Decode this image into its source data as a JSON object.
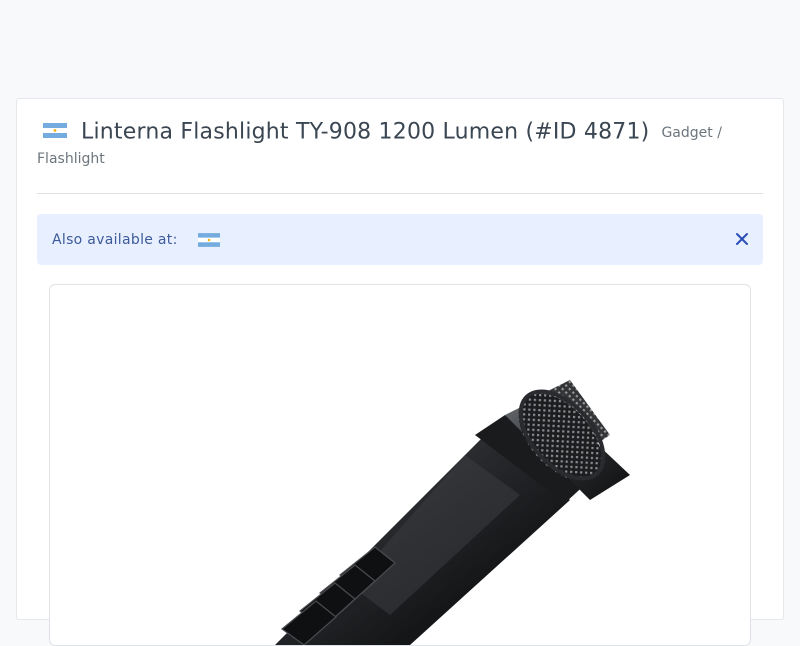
{
  "product": {
    "title": "Linterna Flashlight TY-908 1200 Lumen (#ID 4871)",
    "category_part1": "Gadget /",
    "category_part2": "Flashlight",
    "country_flag": "argentina-flag-icon"
  },
  "alert": {
    "label": "Also available at:",
    "flag": "argentina-flag-icon",
    "close_icon": "close-icon"
  },
  "image": {
    "subject": "flashlight-image"
  },
  "colors": {
    "flag_blue": "#74acdf",
    "flag_sun": "#f6b40e",
    "alert_bg": "#e8efff",
    "alert_text": "#3d5a99",
    "close_icon": "#2c4fb8"
  }
}
